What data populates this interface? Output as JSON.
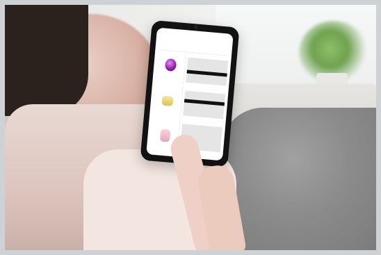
{
  "scene": {
    "description_tags": [
      "person-holding-smartphone",
      "shopping-app",
      "perfume-products"
    ]
  },
  "app": {
    "brand_text": "",
    "header_sub": "",
    "status_left": "",
    "status_right": "",
    "items": [
      {
        "name": "purple-perfume"
      },
      {
        "name": "gold-perfume"
      },
      {
        "name": "pink-perfume"
      }
    ]
  }
}
